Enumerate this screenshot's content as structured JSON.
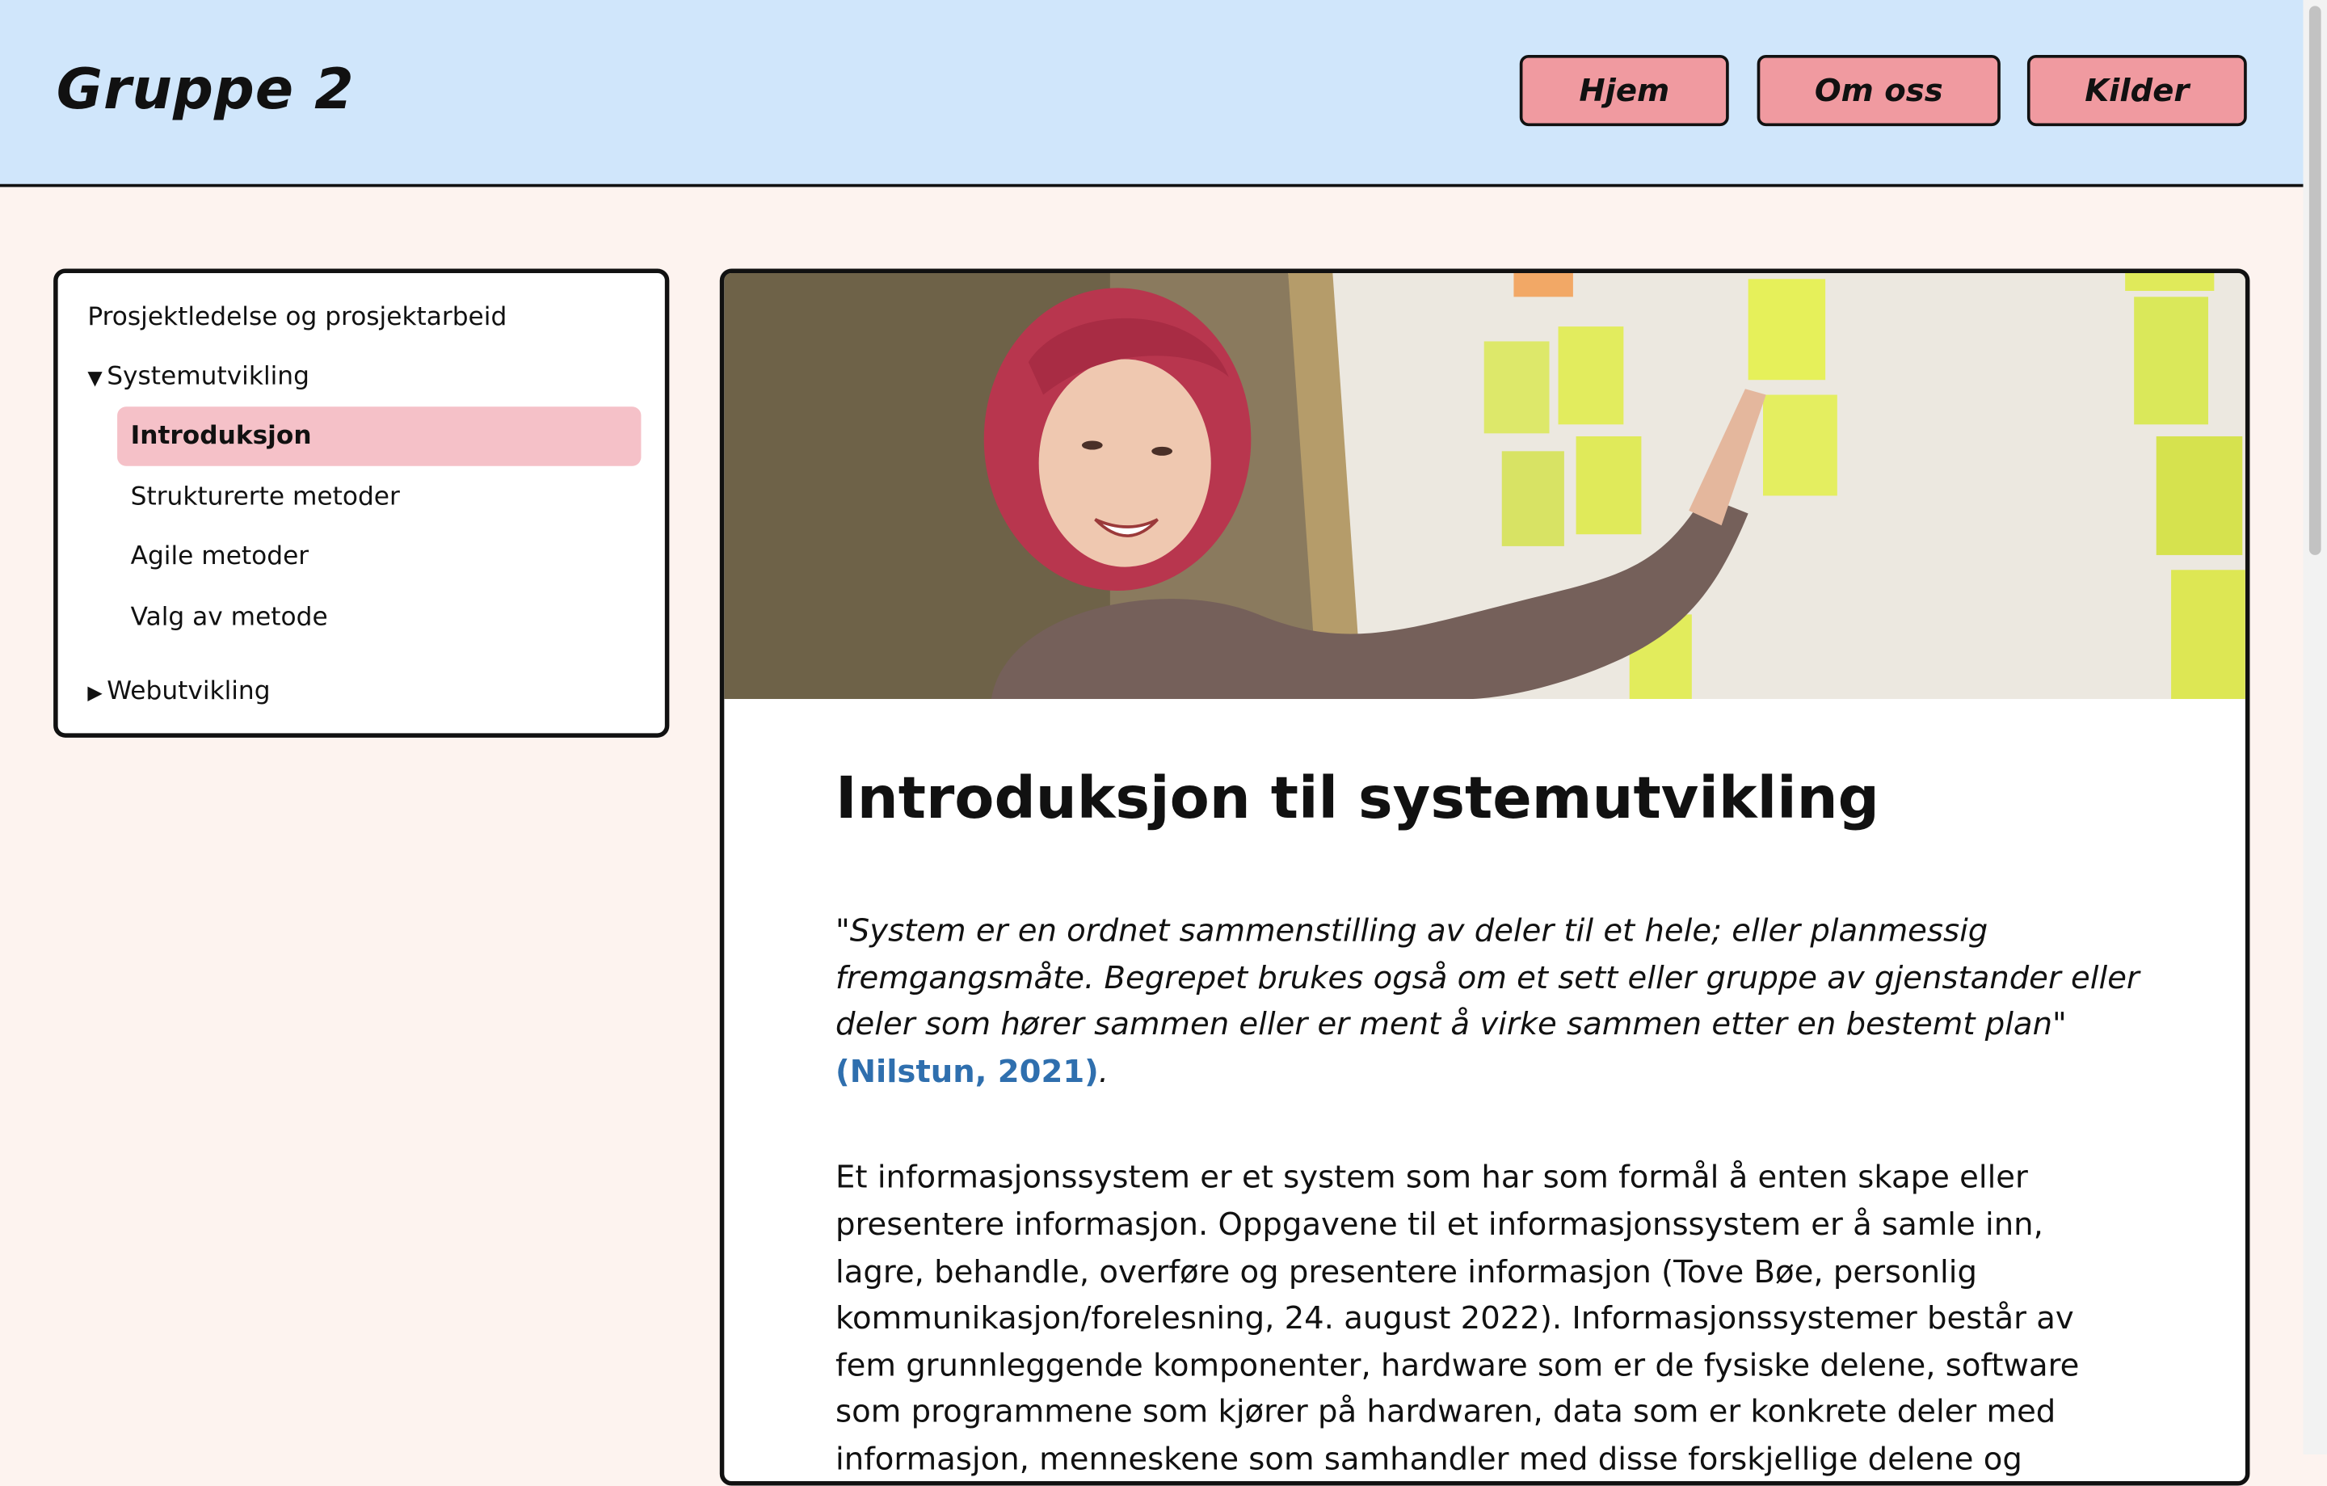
{
  "header": {
    "brand": "Gruppe 2",
    "nav": [
      "Hjem",
      "Om oss",
      "Kilder"
    ]
  },
  "sidebar": {
    "top_link": "Prosjektledelse og prosjektarbeid",
    "sections": [
      {
        "title": "Systemutvikling",
        "expanded": true,
        "items": [
          "Introduksjon",
          "Strukturerte metoder",
          "Agile metoder",
          "Valg av metode"
        ],
        "active_index": 0
      },
      {
        "title": "Webutvikling",
        "expanded": false,
        "items": []
      }
    ],
    "expanded_marker": "▼",
    "collapsed_marker": "▶"
  },
  "main": {
    "title": "Introduksjon til systemutvikling",
    "quote": "\"System er en ordnet sammenstilling av deler til et hele; eller planmessig fremgangsmåte. Begrepet brukes også om et sett eller gruppe av gjenstander eller deler som hører sammen eller er ment å virke sammen etter en bestemt plan\"",
    "quote_citation": "(Nilstun, 2021)",
    "quote_end": ".",
    "paragraph": "Et informasjonssystem er et system som har som formål å enten skape eller presentere informasjon. Oppgavene til et informasjonssystem er å samle inn, lagre, behandle, overføre og presentere informasjon (Tove Bøe, personlig kommunikasjon/forelesning, 24. august 2022). Informasjonssystemer består av fem grunnleggende komponenter, hardware som er de fysiske delene, software som programmene som kjører på hardwaren, data som er konkrete deler med informasjon, menneskene som samhandler med disse forskjellige delene og"
  },
  "colors": {
    "header_bg": "#d0e6fb",
    "page_bg": "#fdf3ef",
    "button_bg": "#f09aa0",
    "active_item_bg": "#f5c1c8",
    "link": "#2f6fae"
  }
}
